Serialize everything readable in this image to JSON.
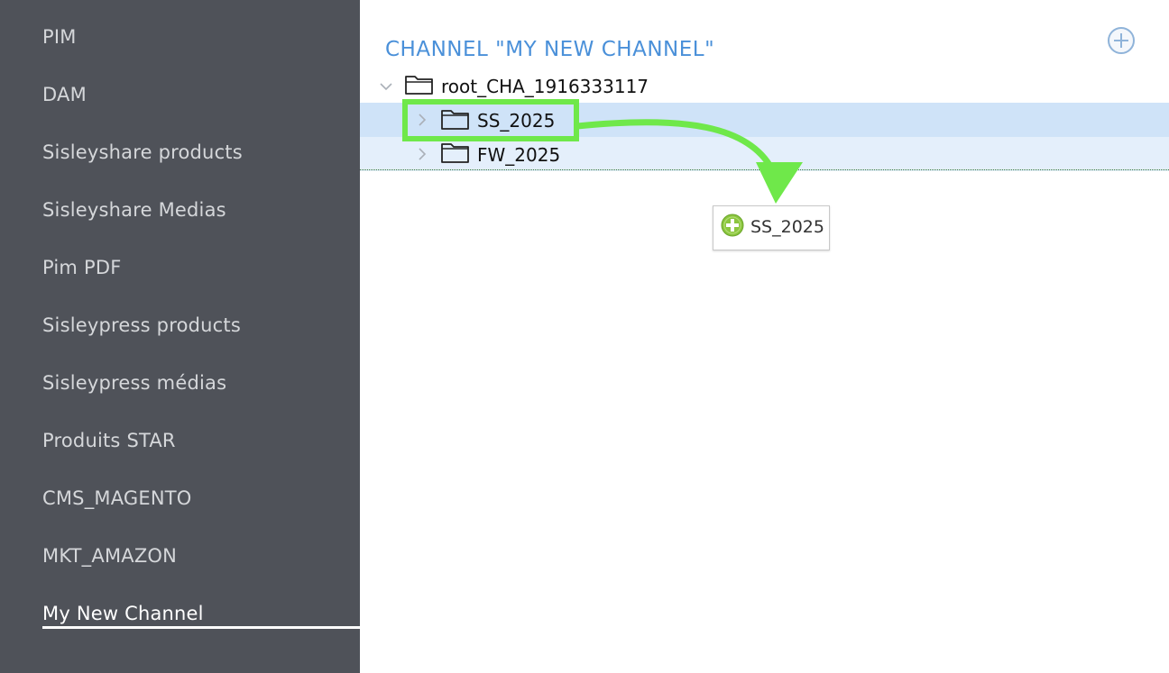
{
  "sidebar": {
    "items": [
      {
        "label": "PIM"
      },
      {
        "label": "DAM"
      },
      {
        "label": "Sisleyshare products"
      },
      {
        "label": "Sisleyshare Medias"
      },
      {
        "label": "Pim PDF"
      },
      {
        "label": "Sisleypress products"
      },
      {
        "label": "Sisleypress médias"
      },
      {
        "label": "Produits STAR"
      },
      {
        "label": "CMS_MAGENTO"
      },
      {
        "label": "MKT_AMAZON"
      },
      {
        "label": "My New Channel"
      }
    ],
    "active_item": "My New Channel"
  },
  "main": {
    "title": "CHANNEL \"MY NEW CHANNEL\"",
    "add_icon": "add-circle-icon",
    "tree": {
      "root": {
        "label": "root_CHA_1916333117",
        "expanded": true
      },
      "children": [
        {
          "label": "SS_2025",
          "expanded": false,
          "selected": true
        },
        {
          "label": "FW_2025",
          "expanded": false,
          "selected": false
        }
      ]
    },
    "drag_ghost": {
      "label": "SS_2025",
      "icon": "add-green-icon"
    }
  },
  "colors": {
    "sidebar_bg": "#4f5259",
    "title_blue": "#4a90d9",
    "selected_row": "#cfe3f8",
    "hover_row": "#e4effb",
    "annotation_green": "#6fe84a"
  }
}
